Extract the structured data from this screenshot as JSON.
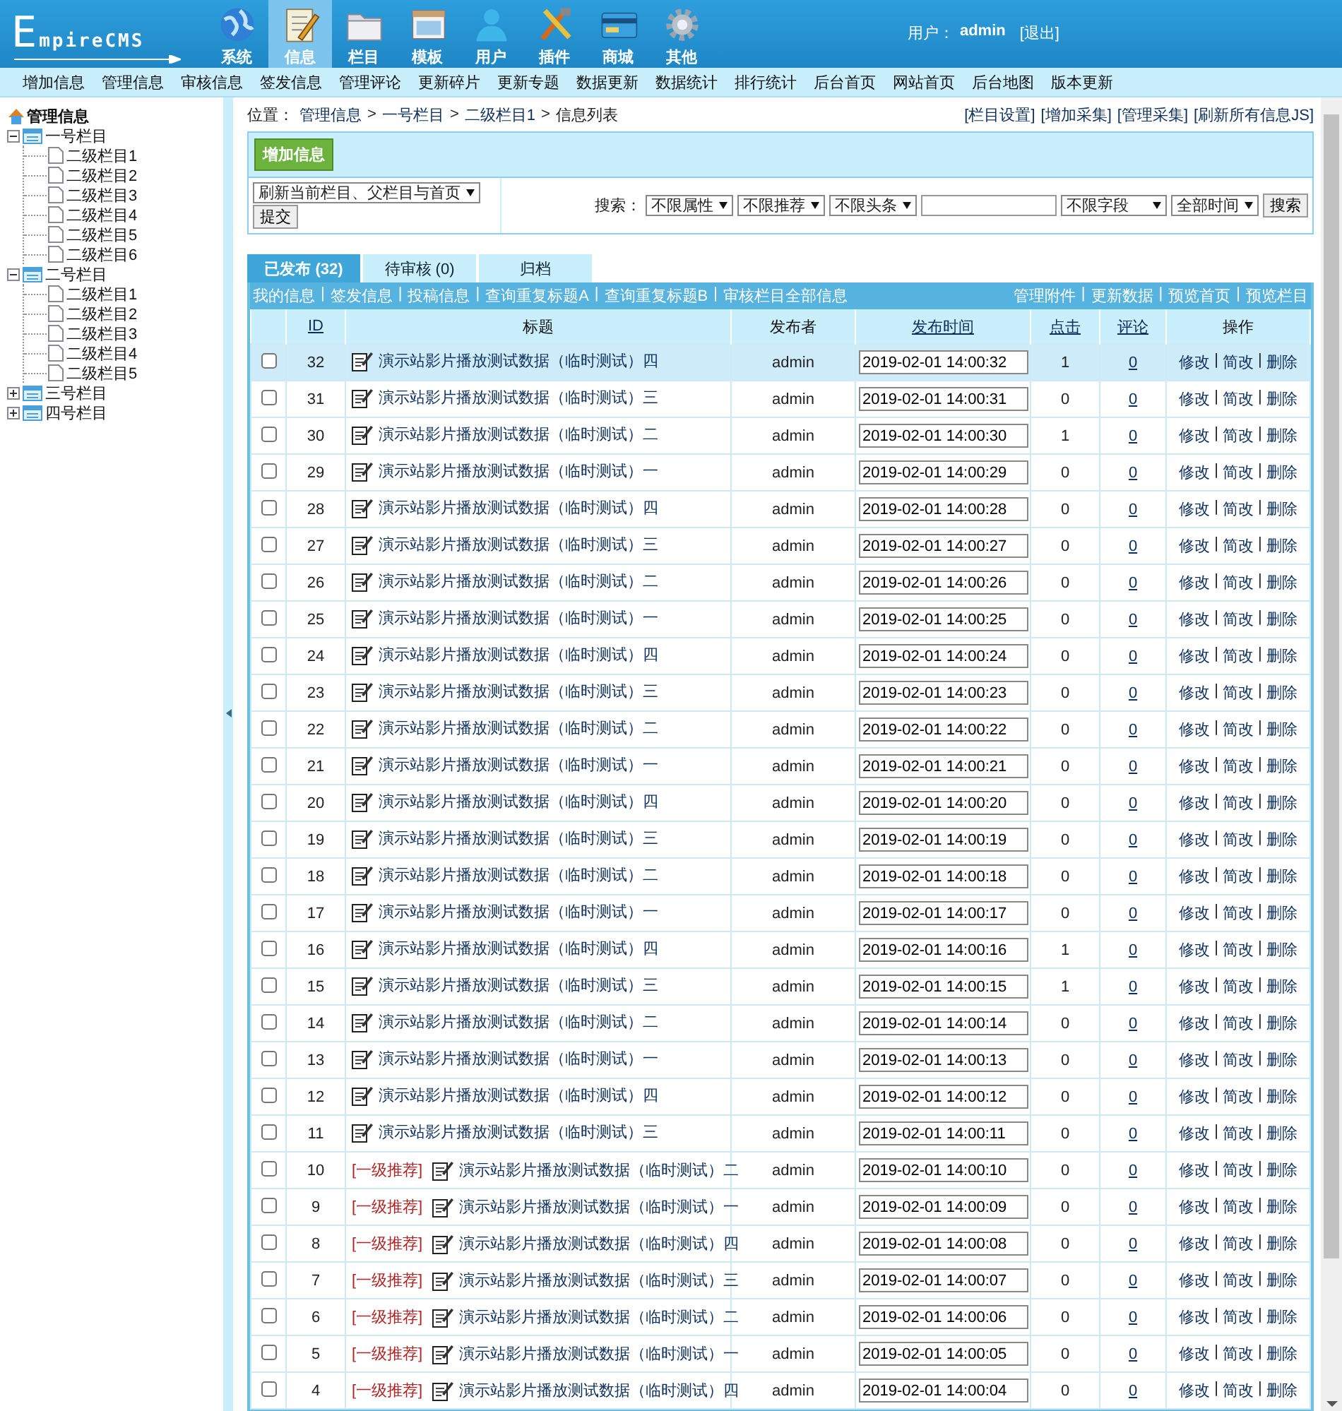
{
  "header": {
    "logo": "EmpireCMS",
    "nav": [
      {
        "label": "系统",
        "selected": false
      },
      {
        "label": "信息",
        "selected": true
      },
      {
        "label": "栏目",
        "selected": false
      },
      {
        "label": "模板",
        "selected": false
      },
      {
        "label": "用户",
        "selected": false
      },
      {
        "label": "插件",
        "selected": false
      },
      {
        "label": "商城",
        "selected": false
      },
      {
        "label": "其他",
        "selected": false
      }
    ],
    "user_label": "用户：",
    "user": "admin",
    "logout": "[退出]"
  },
  "menu": [
    "增加信息",
    "管理信息",
    "审核信息",
    "签发信息",
    "管理评论",
    "更新碎片",
    "更新专题",
    "数据更新",
    "数据统计",
    "排行统计",
    "后台首页",
    "网站首页",
    "后台地图",
    "版本更新"
  ],
  "tree": {
    "root": "管理信息",
    "items": [
      {
        "label": "一号栏目",
        "expanded": true,
        "children": [
          {
            "label": "二级栏目1"
          },
          {
            "label": "二级栏目2"
          },
          {
            "label": "二级栏目3"
          },
          {
            "label": "二级栏目4"
          },
          {
            "label": "二级栏目5"
          },
          {
            "label": "二级栏目6"
          }
        ]
      },
      {
        "label": "二号栏目",
        "expanded": true,
        "children": [
          {
            "label": "二级栏目1"
          },
          {
            "label": "二级栏目2"
          },
          {
            "label": "二级栏目3"
          },
          {
            "label": "二级栏目4"
          },
          {
            "label": "二级栏目5"
          }
        ]
      },
      {
        "label": "三号栏目",
        "expanded": false
      },
      {
        "label": "四号栏目",
        "expanded": false
      }
    ]
  },
  "breadcrumb": {
    "label": "位置：",
    "items": [
      "管理信息",
      "一号栏目",
      "二级栏目1"
    ],
    "separator": ">",
    "current": "信息列表"
  },
  "top_links": [
    "[栏目设置]",
    "[增加采集]",
    "[管理采集]",
    "[刷新所有信息JS]"
  ],
  "add_button": "增加信息",
  "refresh_select": "刷新当前栏目、父栏目与首页",
  "submit_button": "提交",
  "search": {
    "label": "搜索：",
    "filters": [
      "不限属性",
      "不限推荐",
      "不限头条"
    ],
    "field_filter": "不限字段",
    "time_filter": "全部时间",
    "button": "搜索"
  },
  "tabs": [
    {
      "label": "已发布 (32)",
      "selected": true
    },
    {
      "label": "待审核 (0)",
      "selected": false
    },
    {
      "label": "归档",
      "selected": false
    }
  ],
  "action_links": {
    "separator": "|",
    "left": [
      "我的信息",
      "签发信息",
      "投稿信息",
      "查询重复标题A",
      "查询重复标题B",
      "审核栏目全部信息"
    ],
    "right": [
      "管理附件",
      "更新数据",
      "预览首页",
      "预览栏目"
    ]
  },
  "table": {
    "columns": [
      {
        "label": "ID",
        "sortable": true
      },
      {
        "label": "标题",
        "sortable": false
      },
      {
        "label": "发布者",
        "sortable": false
      },
      {
        "label": "发布时间",
        "sortable": true
      },
      {
        "label": "点击",
        "sortable": true
      },
      {
        "label": "评论",
        "sortable": true
      },
      {
        "label": "操作",
        "sortable": false
      }
    ],
    "action_separator": "|",
    "rows": [
      {
        "id": "32",
        "checked": false,
        "selected": true,
        "title": "演示站影片播放测试数据（临时测试）四",
        "publisher": "admin",
        "time": "2019-02-01 14:00:32",
        "clicks": "1",
        "comments": "0",
        "actions": [
          "修改",
          "简改",
          "删除"
        ]
      },
      {
        "id": "31",
        "checked": false,
        "selected": false,
        "title": "演示站影片播放测试数据（临时测试）三",
        "publisher": "admin",
        "time": "2019-02-01 14:00:31",
        "clicks": "0",
        "comments": "0",
        "actions": [
          "修改",
          "简改",
          "删除"
        ]
      },
      {
        "id": "30",
        "checked": false,
        "selected": false,
        "title": "演示站影片播放测试数据（临时测试）二",
        "publisher": "admin",
        "time": "2019-02-01 14:00:30",
        "clicks": "1",
        "comments": "0",
        "actions": [
          "修改",
          "简改",
          "删除"
        ]
      },
      {
        "id": "29",
        "checked": false,
        "selected": false,
        "title": "演示站影片播放测试数据（临时测试）一",
        "publisher": "admin",
        "time": "2019-02-01 14:00:29",
        "clicks": "0",
        "comments": "0",
        "actions": [
          "修改",
          "简改",
          "删除"
        ]
      },
      {
        "id": "28",
        "checked": false,
        "selected": false,
        "title": "演示站影片播放测试数据（临时测试）四",
        "publisher": "admin",
        "time": "2019-02-01 14:00:28",
        "clicks": "0",
        "comments": "0",
        "actions": [
          "修改",
          "简改",
          "删除"
        ]
      },
      {
        "id": "27",
        "checked": false,
        "selected": false,
        "title": "演示站影片播放测试数据（临时测试）三",
        "publisher": "admin",
        "time": "2019-02-01 14:00:27",
        "clicks": "0",
        "comments": "0",
        "actions": [
          "修改",
          "简改",
          "删除"
        ]
      },
      {
        "id": "26",
        "checked": false,
        "selected": false,
        "title": "演示站影片播放测试数据（临时测试）二",
        "publisher": "admin",
        "time": "2019-02-01 14:00:26",
        "clicks": "0",
        "comments": "0",
        "actions": [
          "修改",
          "简改",
          "删除"
        ]
      },
      {
        "id": "25",
        "checked": false,
        "selected": false,
        "title": "演示站影片播放测试数据（临时测试）一",
        "publisher": "admin",
        "time": "2019-02-01 14:00:25",
        "clicks": "0",
        "comments": "0",
        "actions": [
          "修改",
          "简改",
          "删除"
        ]
      },
      {
        "id": "24",
        "checked": false,
        "selected": false,
        "title": "演示站影片播放测试数据（临时测试）四",
        "publisher": "admin",
        "time": "2019-02-01 14:00:24",
        "clicks": "0",
        "comments": "0",
        "actions": [
          "修改",
          "简改",
          "删除"
        ]
      },
      {
        "id": "23",
        "checked": false,
        "selected": false,
        "title": "演示站影片播放测试数据（临时测试）三",
        "publisher": "admin",
        "time": "2019-02-01 14:00:23",
        "clicks": "0",
        "comments": "0",
        "actions": [
          "修改",
          "简改",
          "删除"
        ]
      },
      {
        "id": "22",
        "checked": false,
        "selected": false,
        "title": "演示站影片播放测试数据（临时测试）二",
        "publisher": "admin",
        "time": "2019-02-01 14:00:22",
        "clicks": "0",
        "comments": "0",
        "actions": [
          "修改",
          "简改",
          "删除"
        ]
      },
      {
        "id": "21",
        "checked": false,
        "selected": false,
        "title": "演示站影片播放测试数据（临时测试）一",
        "publisher": "admin",
        "time": "2019-02-01 14:00:21",
        "clicks": "0",
        "comments": "0",
        "actions": [
          "修改",
          "简改",
          "删除"
        ]
      },
      {
        "id": "20",
        "checked": false,
        "selected": false,
        "title": "演示站影片播放测试数据（临时测试）四",
        "publisher": "admin",
        "time": "2019-02-01 14:00:20",
        "clicks": "0",
        "comments": "0",
        "actions": [
          "修改",
          "简改",
          "删除"
        ]
      },
      {
        "id": "19",
        "checked": false,
        "selected": false,
        "title": "演示站影片播放测试数据（临时测试）三",
        "publisher": "admin",
        "time": "2019-02-01 14:00:19",
        "clicks": "0",
        "comments": "0",
        "actions": [
          "修改",
          "简改",
          "删除"
        ]
      },
      {
        "id": "18",
        "checked": false,
        "selected": false,
        "title": "演示站影片播放测试数据（临时测试）二",
        "publisher": "admin",
        "time": "2019-02-01 14:00:18",
        "clicks": "0",
        "comments": "0",
        "actions": [
          "修改",
          "简改",
          "删除"
        ]
      },
      {
        "id": "17",
        "checked": false,
        "selected": false,
        "title": "演示站影片播放测试数据（临时测试）一",
        "publisher": "admin",
        "time": "2019-02-01 14:00:17",
        "clicks": "0",
        "comments": "0",
        "actions": [
          "修改",
          "简改",
          "删除"
        ]
      },
      {
        "id": "16",
        "checked": false,
        "selected": false,
        "title": "演示站影片播放测试数据（临时测试）四",
        "publisher": "admin",
        "time": "2019-02-01 14:00:16",
        "clicks": "1",
        "comments": "0",
        "actions": [
          "修改",
          "简改",
          "删除"
        ]
      },
      {
        "id": "15",
        "checked": false,
        "selected": false,
        "title": "演示站影片播放测试数据（临时测试）三",
        "publisher": "admin",
        "time": "2019-02-01 14:00:15",
        "clicks": "1",
        "comments": "0",
        "actions": [
          "修改",
          "简改",
          "删除"
        ]
      },
      {
        "id": "14",
        "checked": false,
        "selected": false,
        "title": "演示站影片播放测试数据（临时测试）二",
        "publisher": "admin",
        "time": "2019-02-01 14:00:14",
        "clicks": "0",
        "comments": "0",
        "actions": [
          "修改",
          "简改",
          "删除"
        ]
      },
      {
        "id": "13",
        "checked": false,
        "selected": false,
        "title": "演示站影片播放测试数据（临时测试）一",
        "publisher": "admin",
        "time": "2019-02-01 14:00:13",
        "clicks": "0",
        "comments": "0",
        "actions": [
          "修改",
          "简改",
          "删除"
        ]
      },
      {
        "id": "12",
        "checked": false,
        "selected": false,
        "title": "演示站影片播放测试数据（临时测试）四",
        "publisher": "admin",
        "time": "2019-02-01 14:00:12",
        "clicks": "0",
        "comments": "0",
        "actions": [
          "修改",
          "简改",
          "删除"
        ]
      },
      {
        "id": "11",
        "checked": false,
        "selected": false,
        "title": "演示站影片播放测试数据（临时测试）三",
        "publisher": "admin",
        "time": "2019-02-01 14:00:11",
        "clicks": "0",
        "comments": "0",
        "actions": [
          "修改",
          "简改",
          "删除"
        ]
      },
      {
        "id": "10",
        "checked": false,
        "selected": false,
        "tag": "[一级推荐]",
        "title": "演示站影片播放测试数据（临时测试）二",
        "publisher": "admin",
        "time": "2019-02-01 14:00:10",
        "clicks": "0",
        "comments": "0",
        "actions": [
          "修改",
          "简改",
          "删除"
        ]
      },
      {
        "id": "9",
        "checked": false,
        "selected": false,
        "tag": "[一级推荐]",
        "title": "演示站影片播放测试数据（临时测试）一",
        "publisher": "admin",
        "time": "2019-02-01 14:00:09",
        "clicks": "0",
        "comments": "0",
        "actions": [
          "修改",
          "简改",
          "删除"
        ]
      },
      {
        "id": "8",
        "checked": false,
        "selected": false,
        "tag": "[一级推荐]",
        "title": "演示站影片播放测试数据（临时测试）四",
        "publisher": "admin",
        "time": "2019-02-01 14:00:08",
        "clicks": "0",
        "comments": "0",
        "actions": [
          "修改",
          "简改",
          "删除"
        ]
      },
      {
        "id": "7",
        "checked": false,
        "selected": false,
        "tag": "[一级推荐]",
        "title": "演示站影片播放测试数据（临时测试）三",
        "publisher": "admin",
        "time": "2019-02-01 14:00:07",
        "clicks": "0",
        "comments": "0",
        "actions": [
          "修改",
          "简改",
          "删除"
        ]
      },
      {
        "id": "6",
        "checked": false,
        "selected": false,
        "tag": "[一级推荐]",
        "title": "演示站影片播放测试数据（临时测试）二",
        "publisher": "admin",
        "time": "2019-02-01 14:00:06",
        "clicks": "0",
        "comments": "0",
        "actions": [
          "修改",
          "简改",
          "删除"
        ]
      },
      {
        "id": "5",
        "checked": false,
        "selected": false,
        "tag": "[一级推荐]",
        "title": "演示站影片播放测试数据（临时测试）一",
        "publisher": "admin",
        "time": "2019-02-01 14:00:05",
        "clicks": "0",
        "comments": "0",
        "actions": [
          "修改",
          "简改",
          "删除"
        ]
      },
      {
        "id": "4",
        "checked": false,
        "selected": false,
        "tag": "[一级推荐]",
        "title": "演示站影片播放测试数据（临时测试）四",
        "publisher": "admin",
        "time": "2019-02-01 14:00:04",
        "clicks": "0",
        "comments": "0",
        "actions": [
          "修改",
          "简改",
          "删除"
        ]
      }
    ]
  }
}
